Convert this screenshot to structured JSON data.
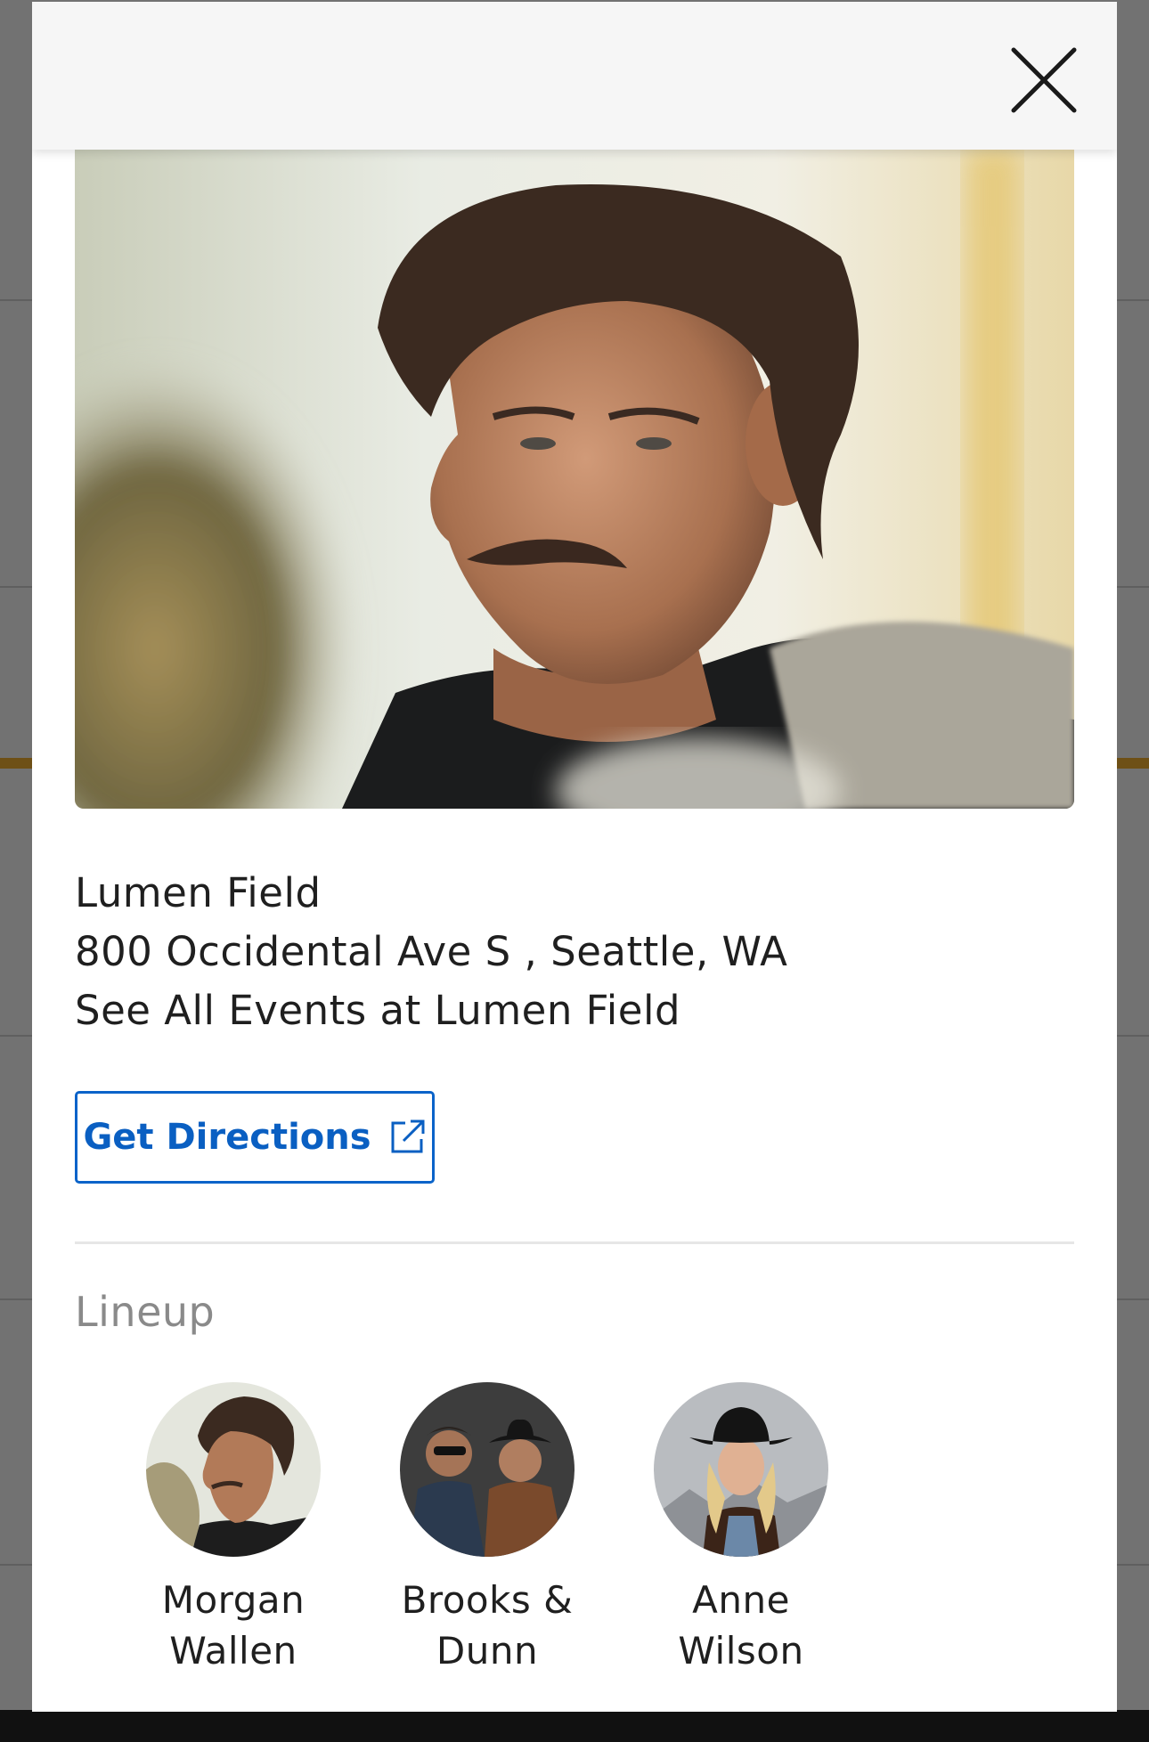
{
  "venue": {
    "name": "Lumen Field",
    "address": "800 Occidental Ave S , Seattle, WA",
    "see_all": "See All Events at Lumen Field"
  },
  "actions": {
    "directions_label": "Get Directions"
  },
  "lineup": {
    "title": "Lineup",
    "artists": [
      {
        "name_line1": "Morgan",
        "name_line2": "Wallen"
      },
      {
        "name_line1": "Brooks &",
        "name_line2": "Dunn"
      },
      {
        "name_line1": "Anne Wilson",
        "name_line2": ""
      }
    ]
  },
  "icons": {
    "close": "close-icon",
    "external_link": "external-link-icon"
  },
  "colors": {
    "accent": "#0a63c9",
    "text": "#1f1f1f",
    "muted": "#8a8a8a",
    "header_bg": "#f6f6f6"
  }
}
